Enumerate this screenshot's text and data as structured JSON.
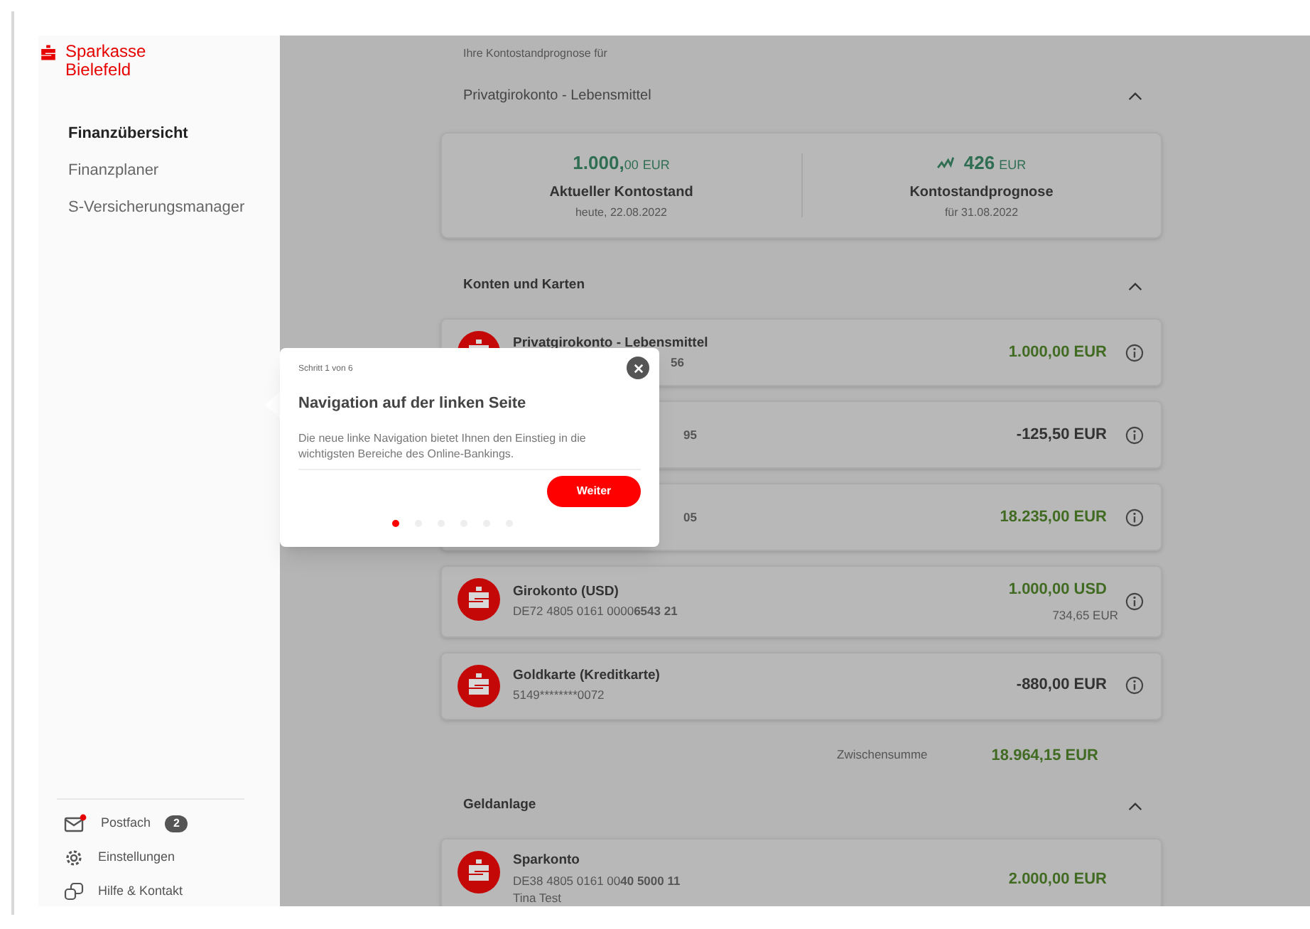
{
  "sidebar": {
    "logo": {
      "line1": "Sparkasse",
      "line2": "Bielefeld"
    },
    "nav": [
      {
        "label": "Finanzübersicht",
        "selected": true
      },
      {
        "label": "Finanzplaner",
        "selected": false
      },
      {
        "label": "S-Versicherungsmanager",
        "selected": false
      }
    ],
    "footer": [
      {
        "kind": "mail",
        "label": "Postfach",
        "badge": "2",
        "unread": true
      },
      {
        "kind": "settings",
        "label": "Einstellungen"
      },
      {
        "kind": "help",
        "label": "Hilfe & Kontakt"
      }
    ]
  },
  "forecast": {
    "intro": "Ihre Kontostandprognose für",
    "account": "Privatgirokonto - Lebensmittel",
    "expanded": true,
    "current": {
      "amount": "1.000,",
      "cents": "00",
      "currency": "EUR",
      "label": "Aktueller Kontostand",
      "date": "heute, 22.08.2022"
    },
    "prognosis": {
      "amount": "426",
      "currency": "EUR",
      "label": "Kontostandprognose",
      "date": "für 31.08.2022"
    }
  },
  "sections": [
    {
      "title": "Konten und Karten",
      "expanded": true,
      "accounts": [
        {
          "name": "Privatgirokonto - Lebensmittel",
          "iban_bold": "56",
          "covered": true,
          "amount": "1.000,00 EUR",
          "color": "#416b22"
        },
        {
          "iban_bold": "95",
          "covered": true,
          "amount": "-125,50 EUR",
          "color": "#333333"
        },
        {
          "iban_bold": "05",
          "covered": true,
          "amount": "18.235,00 EUR",
          "color": "#416b22"
        },
        {
          "name": "Girokonto (USD)",
          "iban": "DE72 4805 0161 0000",
          "iban_bold": "6543 21",
          "covered": false,
          "amount": "1.000,00 USD",
          "sub_amount": "734,65 EUR",
          "color": "#416b22"
        },
        {
          "name": "Goldkarte (Kreditkarte)",
          "iban": "5149********0072",
          "covered": false,
          "amount": "-880,00 EUR",
          "color": "#333333"
        }
      ],
      "subtotal": {
        "label": "Zwischensumme",
        "amount": "18.964,15 EUR"
      }
    },
    {
      "title": "Geldanlage",
      "expanded": true,
      "accounts": [
        {
          "name": "Sparkonto",
          "iban": "DE38 4805 0161 00",
          "iban_bold": "40 5000 11",
          "owner": "Tina Test",
          "covered": false,
          "amount": "2.000,00 EUR",
          "color": "#416b22"
        }
      ]
    }
  ],
  "tour": {
    "step": "Schritt 1 von 6",
    "title": "Navigation auf der linken Seite",
    "text": "Die neue linke Navigation bietet Ihnen den Einstieg in die wichtigsten Bereiche des Online-Bankings.",
    "button": "Weiter",
    "dots": [
      {
        "selected": true
      },
      {
        "selected": false
      },
      {
        "selected": false
      },
      {
        "selected": false
      },
      {
        "selected": false
      },
      {
        "selected": false
      }
    ]
  }
}
